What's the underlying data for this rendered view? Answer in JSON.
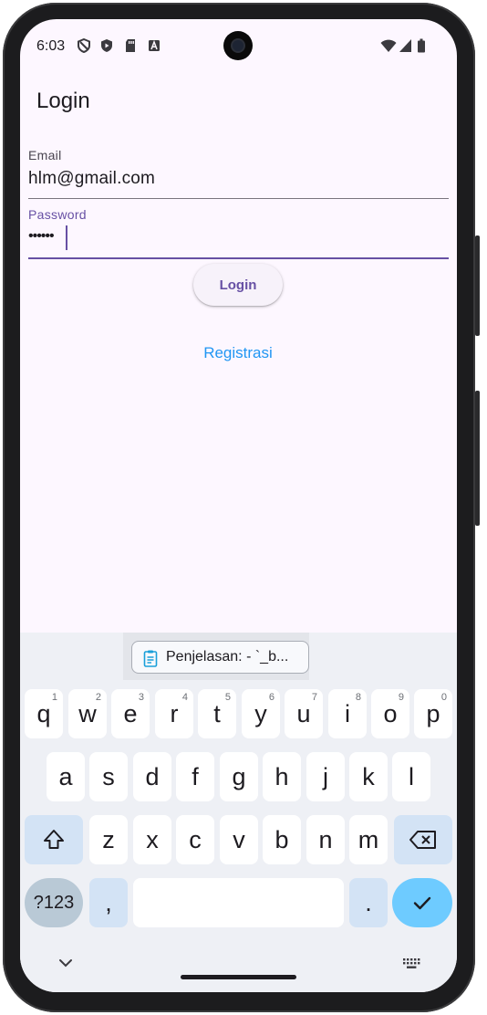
{
  "status_bar": {
    "time": "6:03",
    "left_icons": [
      "shield-icon",
      "play-protect-icon",
      "sd-card-icon",
      "text-format-icon"
    ],
    "right_icons": [
      "wifi-icon",
      "signal-icon",
      "battery-icon"
    ]
  },
  "app_bar": {
    "title": "Login"
  },
  "form": {
    "email_label": "Email",
    "email_value": "hlm@gmail.com",
    "password_label": "Password",
    "password_value": "••••••",
    "login_button": "Login",
    "register_link": "Registrasi"
  },
  "colors": {
    "accent": "#6750a4",
    "link": "#2196f3",
    "background": "#fdf7ff",
    "keyboard_bg": "#eef0f5",
    "enter_key": "#6ecbff"
  },
  "keyboard": {
    "suggestion_chip": "Penjelasan: - `_b...",
    "row1": [
      {
        "k": "q",
        "alt": "1"
      },
      {
        "k": "w",
        "alt": "2"
      },
      {
        "k": "e",
        "alt": "3"
      },
      {
        "k": "r",
        "alt": "4"
      },
      {
        "k": "t",
        "alt": "5"
      },
      {
        "k": "y",
        "alt": "6"
      },
      {
        "k": "u",
        "alt": "7"
      },
      {
        "k": "i",
        "alt": "8"
      },
      {
        "k": "o",
        "alt": "9"
      },
      {
        "k": "p",
        "alt": "0"
      }
    ],
    "row2": [
      "a",
      "s",
      "d",
      "f",
      "g",
      "h",
      "j",
      "k",
      "l"
    ],
    "row3": [
      "z",
      "x",
      "c",
      "v",
      "b",
      "n",
      "m"
    ],
    "symbols_key": "?123",
    "comma_key": ",",
    "period_key": ".",
    "shift_icon": "shift-icon",
    "backspace_icon": "backspace-icon",
    "enter_icon": "check-icon"
  },
  "nav": {
    "hide_keyboard_icon": "chevron-down-icon",
    "keyboard_switch_icon": "keyboard-icon"
  }
}
